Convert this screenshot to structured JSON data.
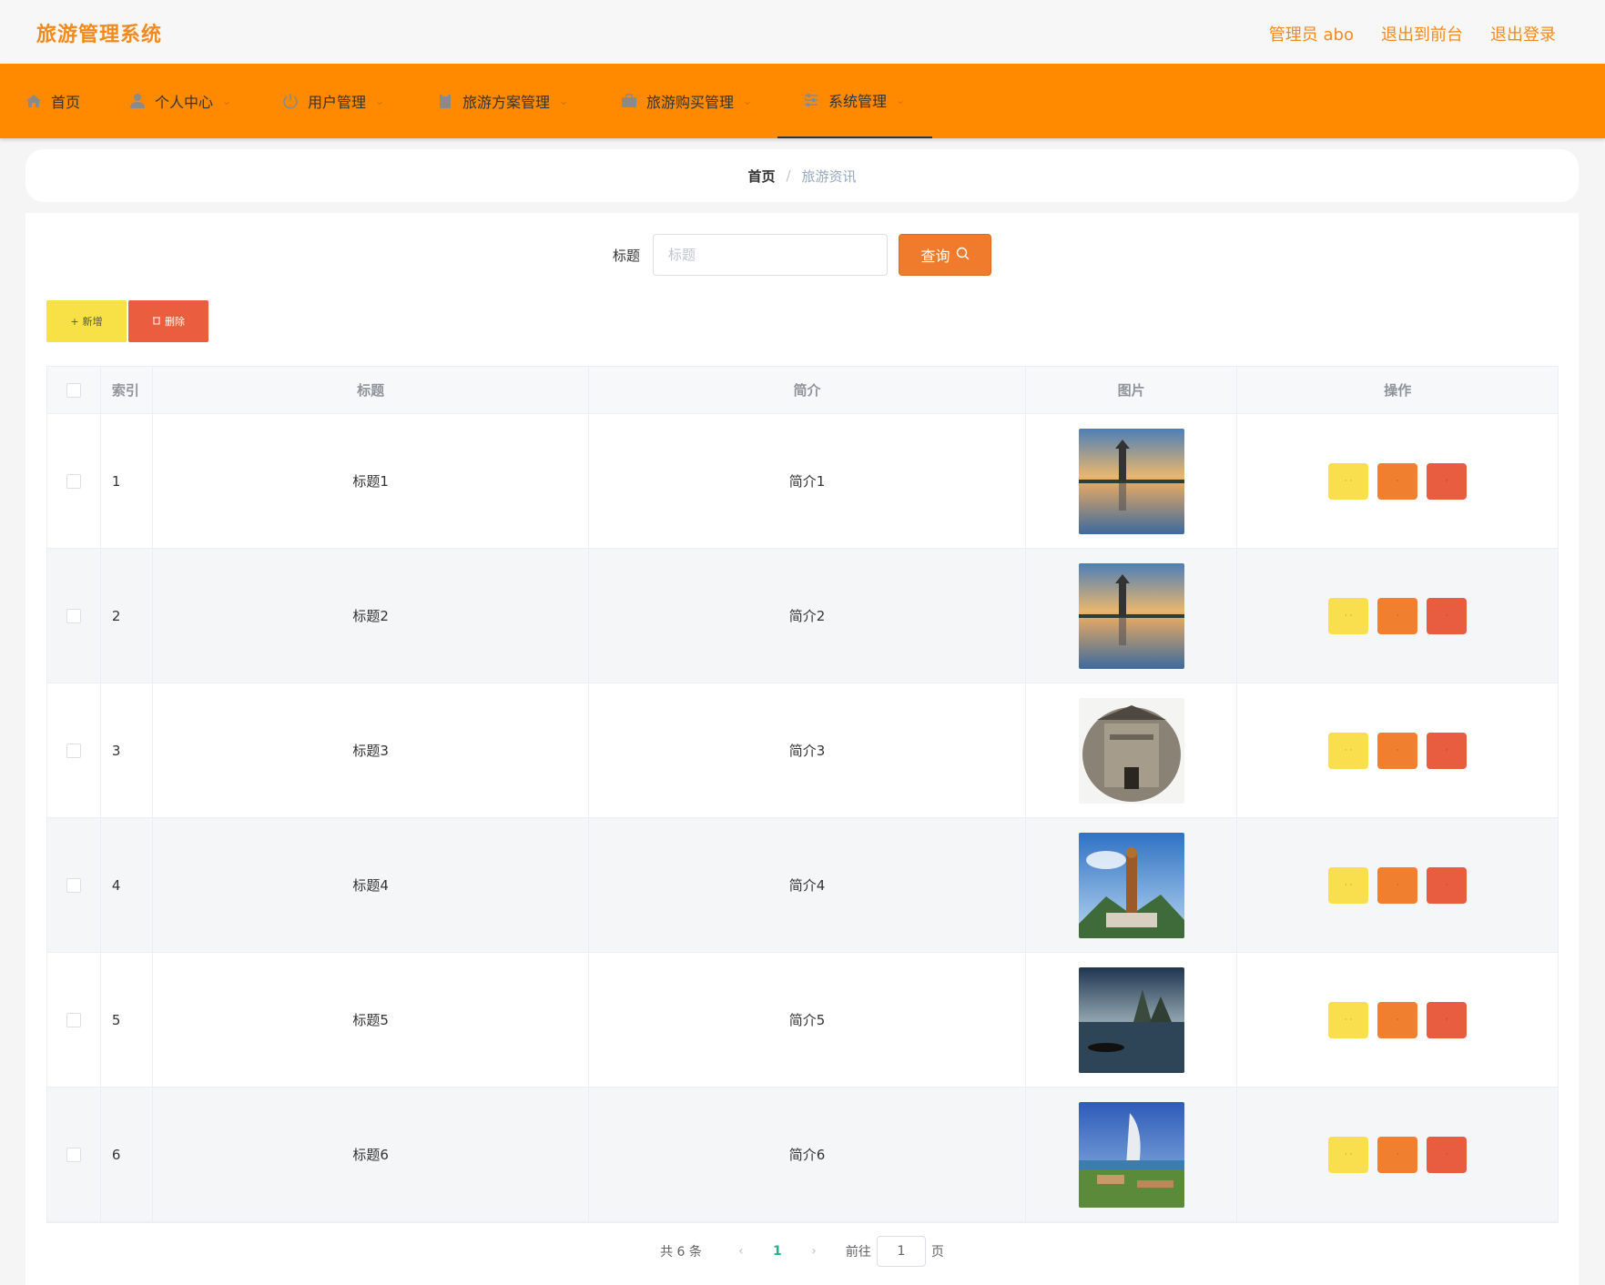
{
  "app": {
    "title": "旅游管理系统"
  },
  "top_links": [
    "管理员 abo",
    "退出到前台",
    "退出登录"
  ],
  "nav": [
    {
      "label": "首页",
      "icon": "home-icon",
      "has_dropdown": false
    },
    {
      "label": "个人中心",
      "icon": "user-icon",
      "has_dropdown": true
    },
    {
      "label": "用户管理",
      "icon": "power-icon",
      "has_dropdown": true
    },
    {
      "label": "旅游方案管理",
      "icon": "clipboard-icon",
      "has_dropdown": true
    },
    {
      "label": "旅游购买管理",
      "icon": "briefcase-icon",
      "has_dropdown": true
    },
    {
      "label": "系统管理",
      "icon": "sliders-icon",
      "has_dropdown": true,
      "active": true
    }
  ],
  "breadcrumb": {
    "home": "首页",
    "separator": "/",
    "current": "旅游资讯"
  },
  "search": {
    "label": "标题",
    "placeholder": "标题",
    "value": "",
    "button_label": "查询"
  },
  "actions": {
    "add_label": "新增",
    "delete_label": "删除"
  },
  "table": {
    "headers": {
      "index": "索引",
      "title": "标题",
      "desc": "简介",
      "image": "图片",
      "ops": "操作"
    },
    "rows": [
      {
        "index": "1",
        "title": "标题1",
        "desc": "简介1",
        "image": "pagoda-lake"
      },
      {
        "index": "2",
        "title": "标题2",
        "desc": "简介2",
        "image": "pagoda-lake"
      },
      {
        "index": "3",
        "title": "标题3",
        "desc": "简介3",
        "image": "ancient-archway"
      },
      {
        "index": "4",
        "title": "标题4",
        "desc": "简介4",
        "image": "buddha-statue"
      },
      {
        "index": "5",
        "title": "标题5",
        "desc": "简介5",
        "image": "karst-river"
      },
      {
        "index": "6",
        "title": "标题6",
        "desc": "简介6",
        "image": "burj-al-arab"
      }
    ]
  },
  "pagination": {
    "total": "共 6 条",
    "current_page": "1",
    "goto_label": "前往",
    "goto_value": "1",
    "page_unit": "页"
  },
  "colors": {
    "brand": "#f38a1d",
    "nav_bg": "#ff8a00",
    "view": "#f9df4d",
    "edit": "#f08030",
    "delete": "#e85c40",
    "page_active": "#1ab394"
  }
}
